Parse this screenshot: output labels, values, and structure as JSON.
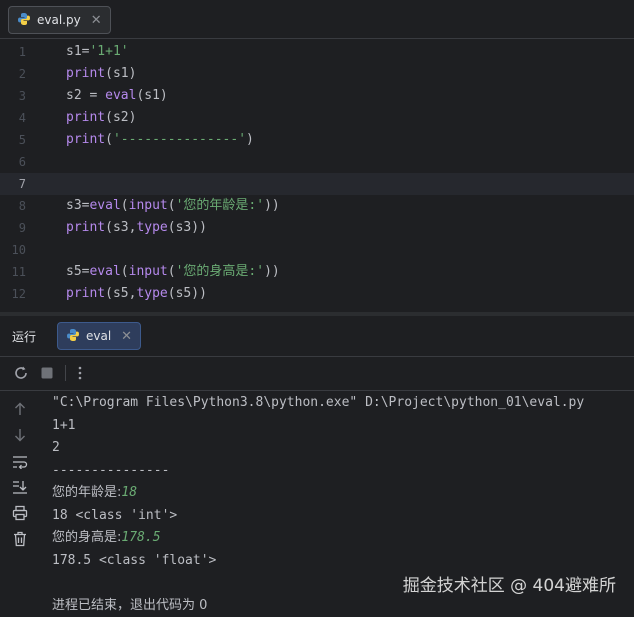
{
  "editor_tab": {
    "filename": "eval.py"
  },
  "editor": {
    "current_line": 7,
    "line_numbers": [
      "1",
      "2",
      "3",
      "4",
      "5",
      "6",
      "7",
      "8",
      "9",
      "10",
      "11",
      "12"
    ],
    "lines": [
      [
        {
          "t": "s1=",
          "c": ""
        },
        {
          "t": "'1+1'",
          "c": "str"
        }
      ],
      [
        {
          "t": "print",
          "c": "fn"
        },
        {
          "t": "(s1)",
          "c": ""
        }
      ],
      [
        {
          "t": "s2 = ",
          "c": ""
        },
        {
          "t": "eval",
          "c": "fn"
        },
        {
          "t": "(s1)",
          "c": ""
        }
      ],
      [
        {
          "t": "print",
          "c": "fn"
        },
        {
          "t": "(s2)",
          "c": ""
        }
      ],
      [
        {
          "t": "print",
          "c": "fn"
        },
        {
          "t": "(",
          "c": ""
        },
        {
          "t": "'---------------'",
          "c": "str"
        },
        {
          "t": ")",
          "c": ""
        }
      ],
      [],
      [],
      [
        {
          "t": "s3=",
          "c": ""
        },
        {
          "t": "eval",
          "c": "fn"
        },
        {
          "t": "(",
          "c": ""
        },
        {
          "t": "input",
          "c": "fn"
        },
        {
          "t": "(",
          "c": ""
        },
        {
          "t": "'您的年龄是:'",
          "c": "str"
        },
        {
          "t": "))",
          "c": ""
        }
      ],
      [
        {
          "t": "print",
          "c": "fn"
        },
        {
          "t": "(s3,",
          "c": ""
        },
        {
          "t": "type",
          "c": "fn"
        },
        {
          "t": "(s3))",
          "c": ""
        }
      ],
      [],
      [
        {
          "t": "s5=",
          "c": ""
        },
        {
          "t": "eval",
          "c": "fn"
        },
        {
          "t": "(",
          "c": ""
        },
        {
          "t": "input",
          "c": "fn"
        },
        {
          "t": "(",
          "c": ""
        },
        {
          "t": "'您的身高是:'",
          "c": "str"
        },
        {
          "t": "))",
          "c": ""
        }
      ],
      [
        {
          "t": "print",
          "c": "fn"
        },
        {
          "t": "(s5,",
          "c": ""
        },
        {
          "t": "type",
          "c": "fn"
        },
        {
          "t": "(s5))",
          "c": ""
        }
      ]
    ]
  },
  "run_panel": {
    "title": "运行",
    "tab_label": "eval"
  },
  "console": {
    "lines": [
      [
        {
          "t": "\"C:\\Program Files\\Python3.8\\python.exe\" D:\\Project\\python_01\\eval.py",
          "c": ""
        }
      ],
      [
        {
          "t": "1+1",
          "c": ""
        }
      ],
      [
        {
          "t": "2",
          "c": ""
        }
      ],
      [
        {
          "t": "---------------",
          "c": ""
        }
      ],
      [
        {
          "t": "您的年龄是:",
          "c": "cjk"
        },
        {
          "t": "18",
          "c": "inp"
        }
      ],
      [
        {
          "t": "18 <class 'int'>",
          "c": ""
        }
      ],
      [
        {
          "t": "您的身高是:",
          "c": "cjk"
        },
        {
          "t": "178.5",
          "c": "inp"
        }
      ],
      [
        {
          "t": "178.5 <class 'float'>",
          "c": ""
        }
      ],
      [],
      [
        {
          "t": "进程已结束，退出代码为 0",
          "c": "cjk"
        }
      ]
    ]
  },
  "watermark": "掘金技术社区 @ 404避难所",
  "colors": {
    "background": "#1e1f22",
    "string": "#6aab73",
    "builtin": "#b589ec",
    "input_echo": "#6aab73",
    "run_tab_bg": "#2e3d5c"
  },
  "icons": {
    "file_tab": "python-icon",
    "run_tab": "python-icon",
    "toolbar": [
      "rerun-icon",
      "stop-icon",
      "more-icon"
    ],
    "side": [
      "scroll-up-icon",
      "scroll-down-icon",
      "soft-wrap-icon",
      "scroll-to-end-icon",
      "print-icon",
      "trash-icon"
    ]
  }
}
